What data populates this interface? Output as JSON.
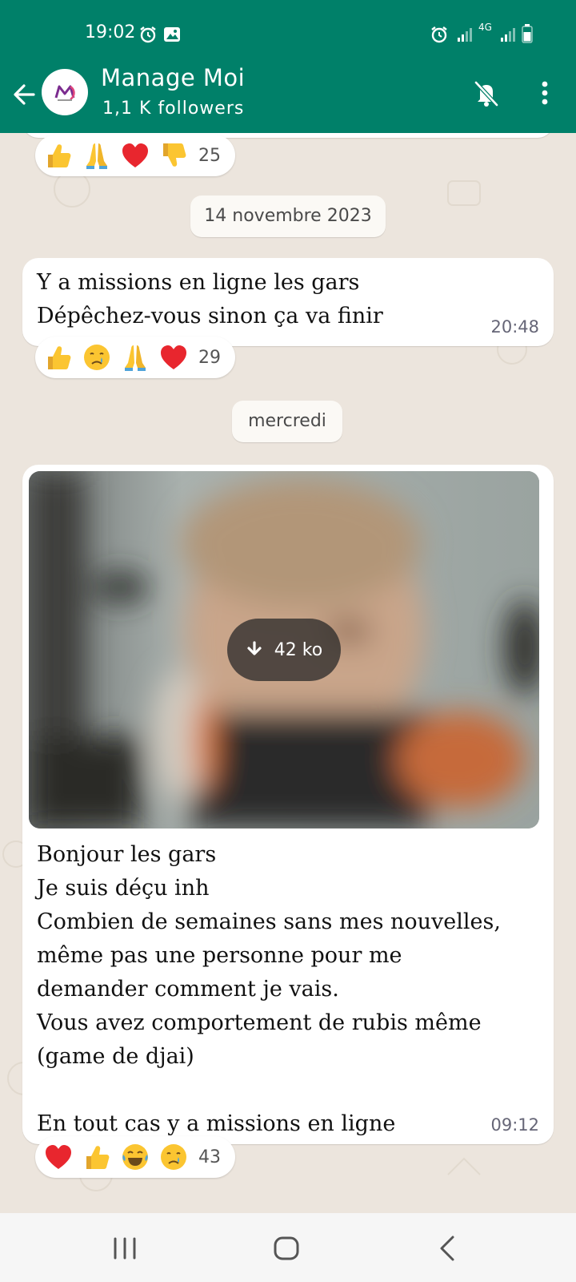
{
  "status_bar": {
    "time": "19:02",
    "network": "4G"
  },
  "header": {
    "title": "Manage Moi",
    "subtitle": "1,1 K followers"
  },
  "messages": [
    {
      "reactions": {
        "emojis": [
          "thumbs-up",
          "folded-hands",
          "red-heart",
          "thumbs-down"
        ],
        "count": "25"
      }
    },
    {
      "date_pill": "14 novembre 2023",
      "text": "Y a missions en ligne les gars\nDépêchez-vous sinon ça va finir",
      "time": "20:48",
      "reactions": {
        "emojis": [
          "thumbs-up",
          "crying-face",
          "folded-hands",
          "red-heart"
        ],
        "count": "29"
      }
    },
    {
      "date_pill": "mercredi",
      "image_download_size": "42 ko",
      "text": "Bonjour les gars\nJe suis déçu inh\nCombien de semaines sans mes nouvelles,\nmême pas une personne pour me\ndemander comment je vais.\nVous avez comportement de rubis même\n(game de djai)\n\nEn tout cas y a missions en ligne",
      "time": "09:12",
      "reactions": {
        "emojis": [
          "red-heart",
          "thumbs-up",
          "tears-of-joy",
          "crying-face"
        ],
        "count": "43"
      }
    }
  ],
  "colors": {
    "header_green": "#008069",
    "chat_background": "#ece5dd",
    "bubble": "#ffffff"
  }
}
